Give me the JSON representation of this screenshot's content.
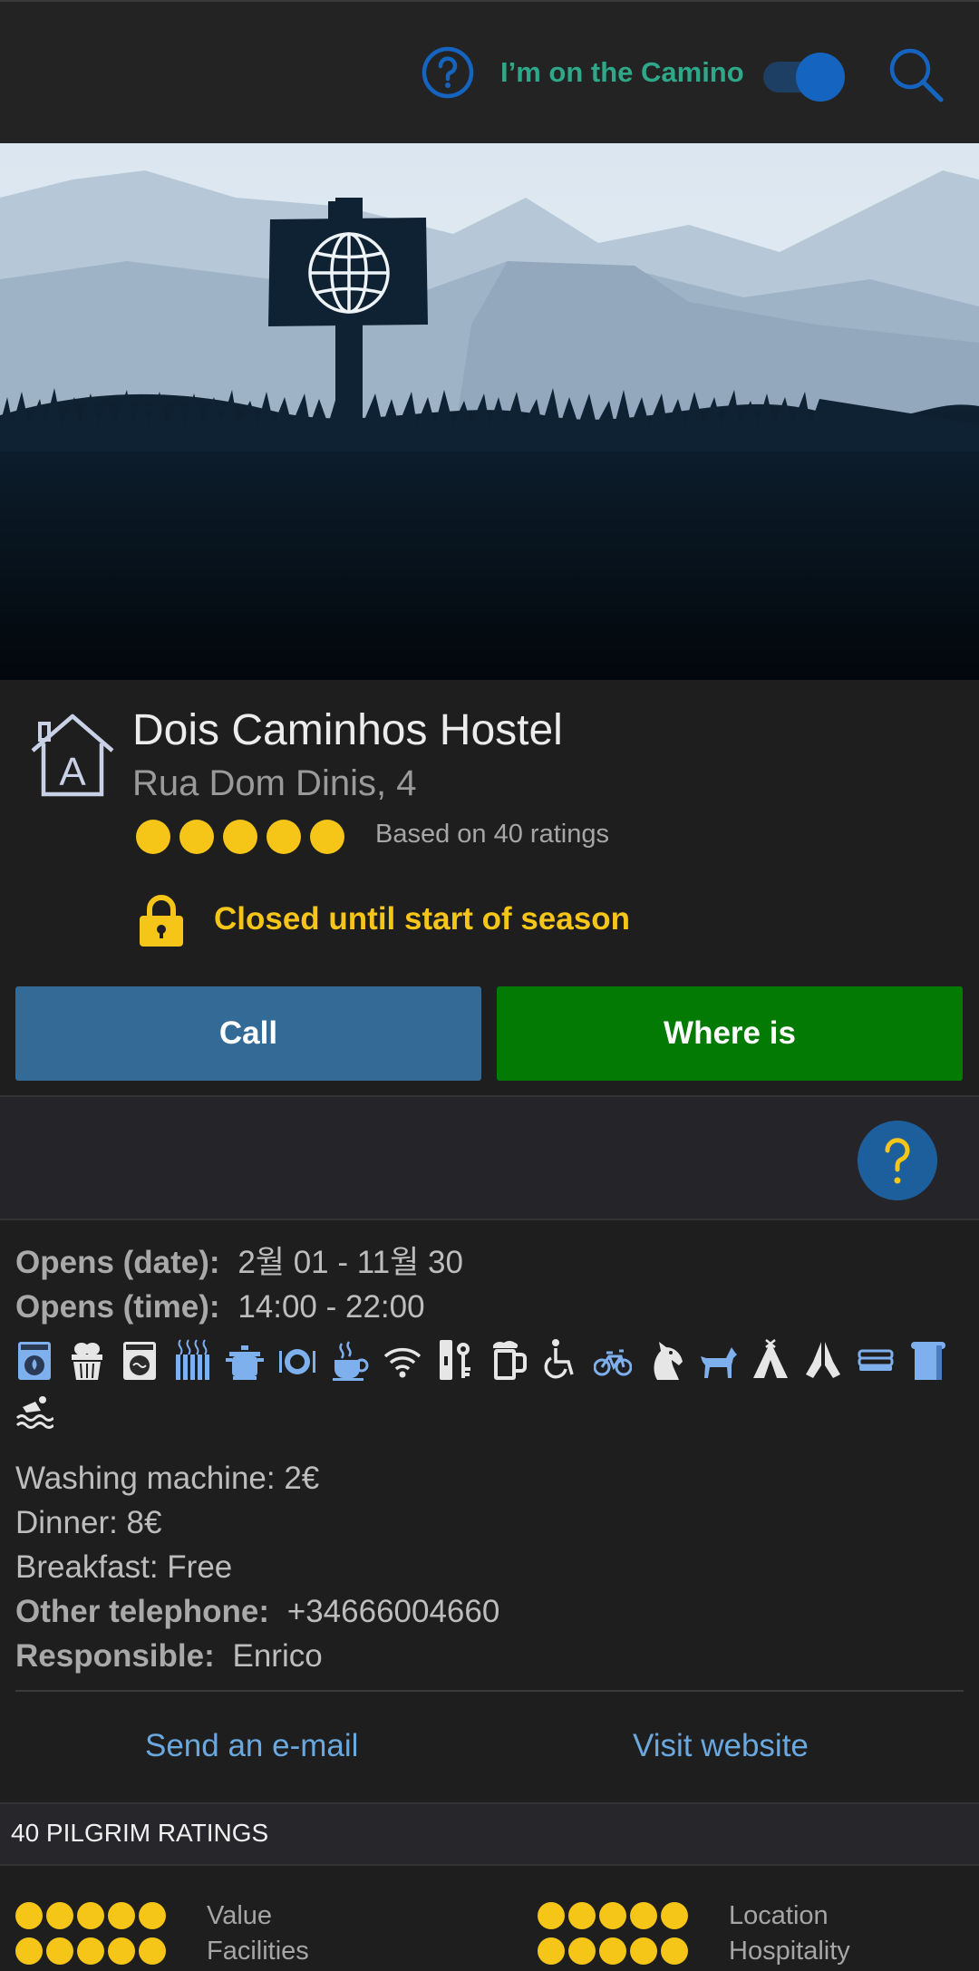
{
  "topbar": {
    "camino_label": "I’m on the Camino",
    "camino_toggle_on": true,
    "help_icon": "help-circle-icon",
    "search_icon": "search-icon",
    "accent": "#1565c0"
  },
  "hostel": {
    "name": "Dois Caminhos Hostel",
    "address": "Rua Dom Dinis, 4",
    "rating": 5,
    "rating_max": 5,
    "rating_count_text": "Based on 40 ratings",
    "status_text": "Closed until start of season",
    "status_color": "#f5c518"
  },
  "actions": {
    "call_label": "Call",
    "where_label": "Where is"
  },
  "details": {
    "opens_date_label": "Opens (date):",
    "opens_date_value": "2월 01 - 11월 30",
    "opens_time_label": "Opens (time):",
    "opens_time_value": "14:00 - 22:00",
    "amenities": [
      "washing-machine-icon",
      "dryer-basket-icon",
      "dryer-icon",
      "heating-icon",
      "kitchen-pot-icon",
      "dinner-plate-icon",
      "coffee-cup-icon",
      "wifi-icon",
      "locker-icon",
      "beer-icon",
      "wheelchair-icon",
      "bicycle-icon",
      "horse-icon",
      "dog-icon",
      "tent-icon",
      "praying-hands-icon",
      "bed-linen-icon",
      "towel-icon",
      "swimming-pool-icon"
    ],
    "washing_machine": "Washing machine: 2€",
    "dinner": "Dinner: 8€",
    "breakfast": "Breakfast: Free",
    "other_tel_label": "Other telephone:",
    "other_tel_value": "+34666004660",
    "responsible_label": "Responsible:",
    "responsible_value": "Enrico",
    "email_link": "Send an e-mail",
    "website_link": "Visit website"
  },
  "ratings": {
    "header": "40 PILGRIM RATINGS",
    "categories": [
      {
        "label": "Value",
        "score": 5
      },
      {
        "label": "Location",
        "score": 5
      },
      {
        "label": "Facilities",
        "score": 5
      },
      {
        "label": "Hospitality",
        "score": 5
      }
    ]
  }
}
